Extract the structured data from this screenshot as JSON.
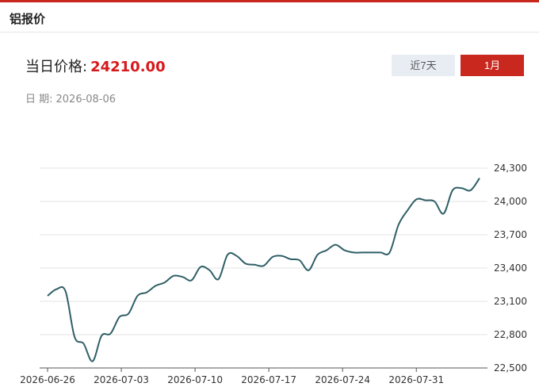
{
  "header": {
    "title": "铝报价"
  },
  "price": {
    "label": "当日价格:",
    "value": "24210.00"
  },
  "date": {
    "label": "日 期:",
    "value": "2026-08-06"
  },
  "range_buttons": [
    {
      "label": "近7天",
      "active": false
    },
    {
      "label": "1月",
      "active": true
    }
  ],
  "colors": {
    "accent": "#c8281e",
    "price": "#d7191c",
    "line": "#2f5f66",
    "inactive_button": "#e8edf4"
  },
  "chart_data": {
    "type": "line",
    "x": [
      "2026-06-26",
      "2026-06-27",
      "2026-06-28",
      "2026-06-29",
      "2026-06-30",
      "2026-07-01",
      "2026-07-02",
      "2026-07-03",
      "2026-07-04",
      "2026-07-05",
      "2026-07-06",
      "2026-07-07",
      "2026-07-08",
      "2026-07-09",
      "2026-07-10",
      "2026-07-11",
      "2026-07-12",
      "2026-07-13",
      "2026-07-14",
      "2026-07-15",
      "2026-07-16",
      "2026-07-17",
      "2026-07-18",
      "2026-07-19",
      "2026-07-20",
      "2026-07-21",
      "2026-07-22",
      "2026-07-23",
      "2026-07-24",
      "2026-07-25",
      "2026-07-26",
      "2026-07-27",
      "2026-07-28",
      "2026-07-29",
      "2026-07-30",
      "2026-07-31",
      "2026-08-01",
      "2026-08-02",
      "2026-08-03",
      "2026-08-04",
      "2026-08-05",
      "2026-08-06"
    ],
    "values": [
      23150,
      23210,
      23190,
      22780,
      22720,
      22560,
      22790,
      22810,
      22960,
      22990,
      23150,
      23180,
      23240,
      23270,
      23330,
      23320,
      23290,
      23410,
      23380,
      23300,
      23520,
      23510,
      23440,
      23430,
      23420,
      23500,
      23510,
      23480,
      23470,
      23380,
      23520,
      23560,
      23610,
      23560,
      23540,
      23540,
      23540,
      23540,
      23540,
      23790,
      23920,
      24020,
      24010,
      24000,
      23890,
      24100,
      24120,
      24100,
      24210
    ],
    "xticks": [
      "2026-06-26",
      "2026-07-03",
      "2026-07-10",
      "2026-07-17",
      "2026-07-24",
      "2026-07-31"
    ],
    "yticks": [
      "22,500",
      "22,800",
      "23,100",
      "23,400",
      "23,700",
      "24,000",
      "24,300"
    ],
    "ylim": [
      22500,
      24300
    ],
    "grid": true
  }
}
